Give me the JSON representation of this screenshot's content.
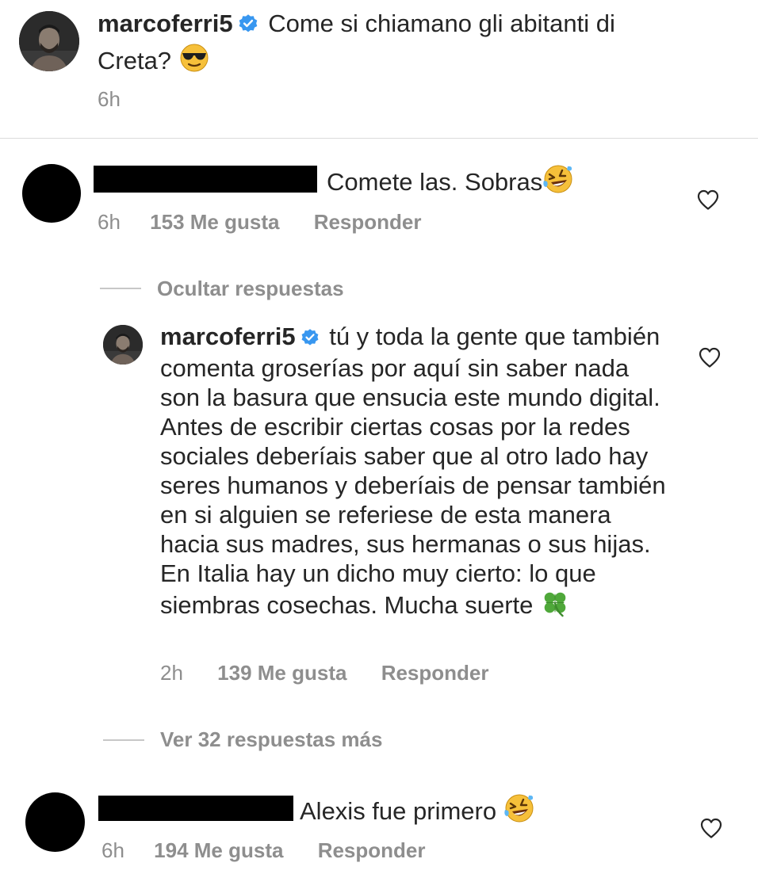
{
  "post": {
    "username": "marcoferri5",
    "caption": "Come si chiamano gli abitanti di Creta?",
    "caption_emoji": "sunglasses-face",
    "time": "6h"
  },
  "comments": [
    {
      "text": "Comete las. Sobras",
      "emoji": "rolling-laughing-face",
      "time": "6h",
      "likes": "153 Me gusta",
      "reply": "Responder",
      "hide_replies": "Ocultar respuestas",
      "replies": [
        {
          "username": "marcoferri5",
          "text": "tú y toda la gente que también comenta groserías por aquí sin saber nada son la basura que ensucia este mundo digital. Antes de escribir ciertas cosas por la redes sociales deberíais saber que al otro lado hay seres humanos y deberíais de pensar también en si alguien se referiese de esta manera hacia sus madres, sus hermanas o sus hijas. En Italia hay un dicho muy cierto: lo que siembras cosechas. Mucha suerte",
          "emoji": "four-leaf-clover",
          "time": "2h",
          "likes": "139 Me gusta",
          "reply": "Responder"
        }
      ],
      "more_replies": "Ver 32 respuestas más"
    },
    {
      "text": "Alexis fue primero",
      "emoji": "rolling-laughing-face",
      "time": "6h",
      "likes": "194 Me gusta",
      "reply": "Responder"
    }
  ],
  "colors": {
    "text": "#262626",
    "meta": "#8e8e8e",
    "verified": "#3897f0",
    "divider": "#dbdbdb"
  }
}
